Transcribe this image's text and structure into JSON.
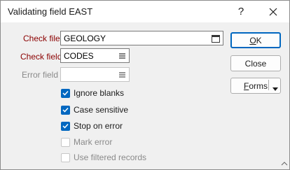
{
  "window": {
    "title": "Validating field EAST",
    "help_glyph": "?",
    "close_icon": "close-icon"
  },
  "form": {
    "check_file": {
      "label": "Check file",
      "value": "GEOLOGY",
      "button_icon": "browse-window-icon"
    },
    "check_field": {
      "label": "Check field",
      "value": "CODES",
      "button_icon": "list-icon"
    },
    "error_field": {
      "label": "Error field",
      "value": "",
      "button_icon": "list-icon"
    }
  },
  "options": [
    {
      "label": "Ignore blanks",
      "checked": true,
      "enabled": true
    },
    {
      "label": "Case sensitive",
      "checked": true,
      "enabled": true
    },
    {
      "label": "Stop on error",
      "checked": true,
      "enabled": true
    },
    {
      "label": "Mark error",
      "checked": false,
      "enabled": false
    },
    {
      "label": "Use filtered records",
      "checked": false,
      "enabled": false
    }
  ],
  "buttons": {
    "ok": "OK",
    "close": "Close",
    "forms": "Forms"
  },
  "colors": {
    "accent": "#0067c0",
    "required_label": "#8b0000",
    "disabled_text": "#8a8a8a"
  }
}
